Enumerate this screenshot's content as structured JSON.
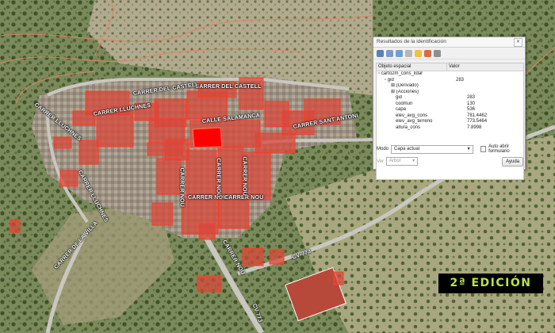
{
  "streets": {
    "carrer_del_castell_top": "CARRER DEL CASTELL",
    "carrer_del_castell_mid": "CARRER DEL CASTELL",
    "carrer_lluchnes": "CARRER LLUCHNES",
    "carrer_lluchnes_left": "CARRER LLUCHNES",
    "carrer_lluchnes_down": "CARRER LLUCHNES",
    "carrer_sant_antoni": "CARRER SANT ANTONI",
    "calle_salamanca": "CALLE SALAMANCA",
    "carrer_nou_v1": "CARRER NOU",
    "carrer_nou_h": "CARRER NOU",
    "carrer_nou_h2": "CARRER NOU",
    "carrer_nou_v2": "CARRER NOU",
    "carrer_nou_v3": "CARRER NOU",
    "carrer_nou_bottom": "CARRER NOU",
    "carrer_de_la_villa": "CARRER DE LA VILLA",
    "cv_road": "CV-773",
    "cv_road2": "CV-773"
  },
  "identify_panel": {
    "title": "Resultados de la identificación",
    "close": "✕",
    "columns": [
      "Objeto espacial",
      "Valor"
    ],
    "layer": "carto2m_cons_lidar",
    "feature_key": "gid",
    "feature_value": "283",
    "derived": "(Derivado)",
    "actions": "(Acciones)",
    "attributes": [
      {
        "key": "gid",
        "value": "283"
      },
      {
        "key": "codmun",
        "value": "130"
      },
      {
        "key": "capa",
        "value": "536"
      },
      {
        "key": "elev_avg_cons",
        "value": "781.4462"
      },
      {
        "key": "elev_avg_terreno",
        "value": "773.5464"
      },
      {
        "key": "altura_cons",
        "value": "7.8998"
      }
    ],
    "mode_label": "Modo",
    "mode_value": "Capa actual",
    "auto_open_label": "Auto abrir formulario",
    "view_label": "Ver",
    "view_value": "Árbol",
    "help_button": "Ayuda",
    "colors": {
      "panel_bg": "#f0f0f0",
      "tree_bg": "#ffffff"
    }
  },
  "badge": {
    "text": "2ª EDICIÓN",
    "bg": "#000000",
    "fg": "#b9e34a"
  },
  "map_colors": {
    "building_fill": "#d9473a",
    "building_outline": "#ff2a1a",
    "selected_fill": "#ff0000",
    "contour": "#d98566",
    "pink_outline": "#e48aa0"
  }
}
